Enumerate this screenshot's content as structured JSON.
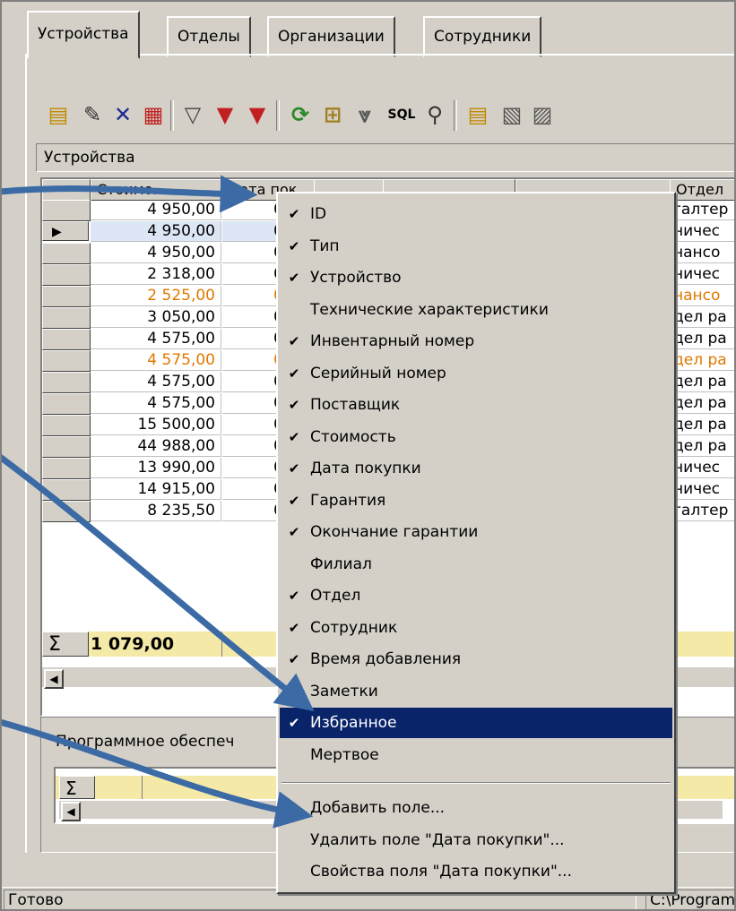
{
  "tabs": [
    "Устройства",
    "Отделы",
    "Организации",
    "Сотрудники"
  ],
  "toolbar": {
    "icons": [
      "new-record-icon",
      "edit-icon",
      "delete-icon",
      "delete-rows-icon",
      "filter-icon",
      "clear-filter-icon",
      "remove-filter-icon",
      "refresh-icon",
      "tree-icon",
      "filter-settings-icon",
      "sql-icon",
      "search-icon",
      "new-document-icon",
      "properties-icon",
      "properties-2-icon"
    ],
    "sql_label": "SQL"
  },
  "section_title": "Устройства",
  "grid": {
    "headers": [
      "Стоимо...",
      "Дата пок",
      "",
      "",
      "",
      "Отдел"
    ],
    "rows": [
      {
        "cost": "4 950,00",
        "date": "08.1",
        "dept": "галтер",
        "style": ""
      },
      {
        "cost": "4 950,00",
        "date": "08.1",
        "dept": "ничес",
        "style": "selected"
      },
      {
        "cost": "4 950,00",
        "date": "08.1",
        "dept": "нансо",
        "style": ""
      },
      {
        "cost": "2 318,00",
        "date": "08.1",
        "dept": "ничес",
        "style": ""
      },
      {
        "cost": "2 525,00",
        "date": "08.1",
        "dept": "нансо",
        "style": "orange"
      },
      {
        "cost": "3 050,00",
        "date": "08.1",
        "dept": "дел ра",
        "style": ""
      },
      {
        "cost": "4 575,00",
        "date": "08.1",
        "dept": "дел ра",
        "style": ""
      },
      {
        "cost": "4 575,00",
        "date": "08.1",
        "dept": "дел ра",
        "style": "orange"
      },
      {
        "cost": "4 575,00",
        "date": "08.1",
        "dept": "дел ра",
        "style": ""
      },
      {
        "cost": "4 575,00",
        "date": "08.1",
        "dept": "дел ра",
        "style": ""
      },
      {
        "cost": "15 500,00",
        "date": "08.1",
        "dept": "дел ра",
        "style": ""
      },
      {
        "cost": "44 988,00",
        "date": "08.1",
        "dept": "дел ра",
        "style": ""
      },
      {
        "cost": "13 990,00",
        "date": "08.1",
        "dept": "ничес",
        "style": ""
      },
      {
        "cost": "14 915,00",
        "date": "08.1",
        "dept": "ничес",
        "style": ""
      },
      {
        "cost": "8 235,50",
        "date": "08.1",
        "dept": "галтер",
        "style": ""
      }
    ],
    "sum_symbol": "Σ",
    "sum_value": "1 079,00"
  },
  "software": {
    "label": "Программное обеспеч",
    "sum_symbol": "Σ"
  },
  "status": {
    "left": "Готово",
    "right": "C:\\Program"
  },
  "context_menu": {
    "items": [
      {
        "label": "ID",
        "checked": true
      },
      {
        "label": "Тип",
        "checked": true
      },
      {
        "label": "Устройство",
        "checked": true
      },
      {
        "label": "Технические характеристики",
        "checked": false
      },
      {
        "label": "Инвентарный номер",
        "checked": true
      },
      {
        "label": "Серийный номер",
        "checked": true
      },
      {
        "label": "Поставщик",
        "checked": true
      },
      {
        "label": "Стоимость",
        "checked": true
      },
      {
        "label": "Дата покупки",
        "checked": true
      },
      {
        "label": "Гарантия",
        "checked": true
      },
      {
        "label": "Окончание гарантии",
        "checked": true
      },
      {
        "label": "Филиал",
        "checked": false
      },
      {
        "label": "Отдел",
        "checked": true
      },
      {
        "label": "Сотрудник",
        "checked": true
      },
      {
        "label": "Время добавления",
        "checked": true
      },
      {
        "label": "Заметки",
        "checked": false
      },
      {
        "label": "Избранное",
        "checked": true,
        "highlighted": true
      },
      {
        "label": "Мертвое",
        "checked": false
      }
    ],
    "actions": [
      "Добавить поле...",
      "Удалить поле \"Дата покупки\"...",
      "Свойства поля \"Дата покупки\"..."
    ],
    "check_glyph": "✔"
  },
  "colors": {
    "window_bg": "#d4d0c8",
    "highlight": "#0a246a",
    "sum_bg": "#f5e9a8",
    "orange_text": "#e07800",
    "arrow": "#3b6aa5"
  }
}
